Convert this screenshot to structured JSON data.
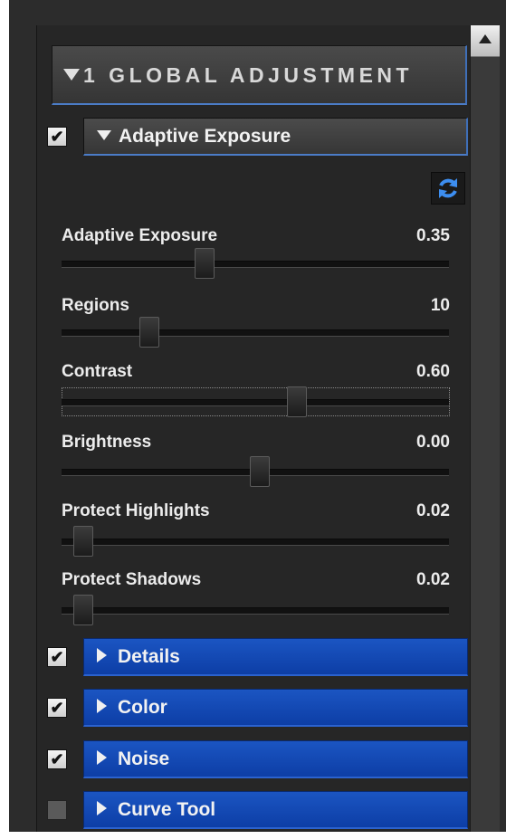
{
  "global_adjustment": {
    "label": "1 GLOBAL ADJUSTMENT"
  },
  "adaptive_exposure_section": {
    "label": "Adaptive Exposure",
    "checked": true,
    "sliders": [
      {
        "label": "Adaptive Exposure",
        "value": "0.35",
        "fraction": 0.35
      },
      {
        "label": "Regions",
        "value": "10",
        "fraction": 0.2
      },
      {
        "label": "Contrast",
        "value": "0.60",
        "fraction": 0.6
      },
      {
        "label": "Brightness",
        "value": "0.00",
        "fraction": 0.5
      },
      {
        "label": "Protect Highlights",
        "value": "0.02",
        "fraction": 0.02
      },
      {
        "label": "Protect Shadows",
        "value": "0.02",
        "fraction": 0.02
      }
    ]
  },
  "sections": [
    {
      "label": "Details",
      "checked": true
    },
    {
      "label": "Color",
      "checked": true
    },
    {
      "label": "Noise",
      "checked": true
    },
    {
      "label": "Curve Tool",
      "checked": false
    }
  ],
  "icons": {
    "reset": "refresh-icon",
    "check": "✔"
  },
  "colors": {
    "accent": "#0d3ea6",
    "focus_border": "#4b7cc7",
    "panel": "#262626"
  }
}
